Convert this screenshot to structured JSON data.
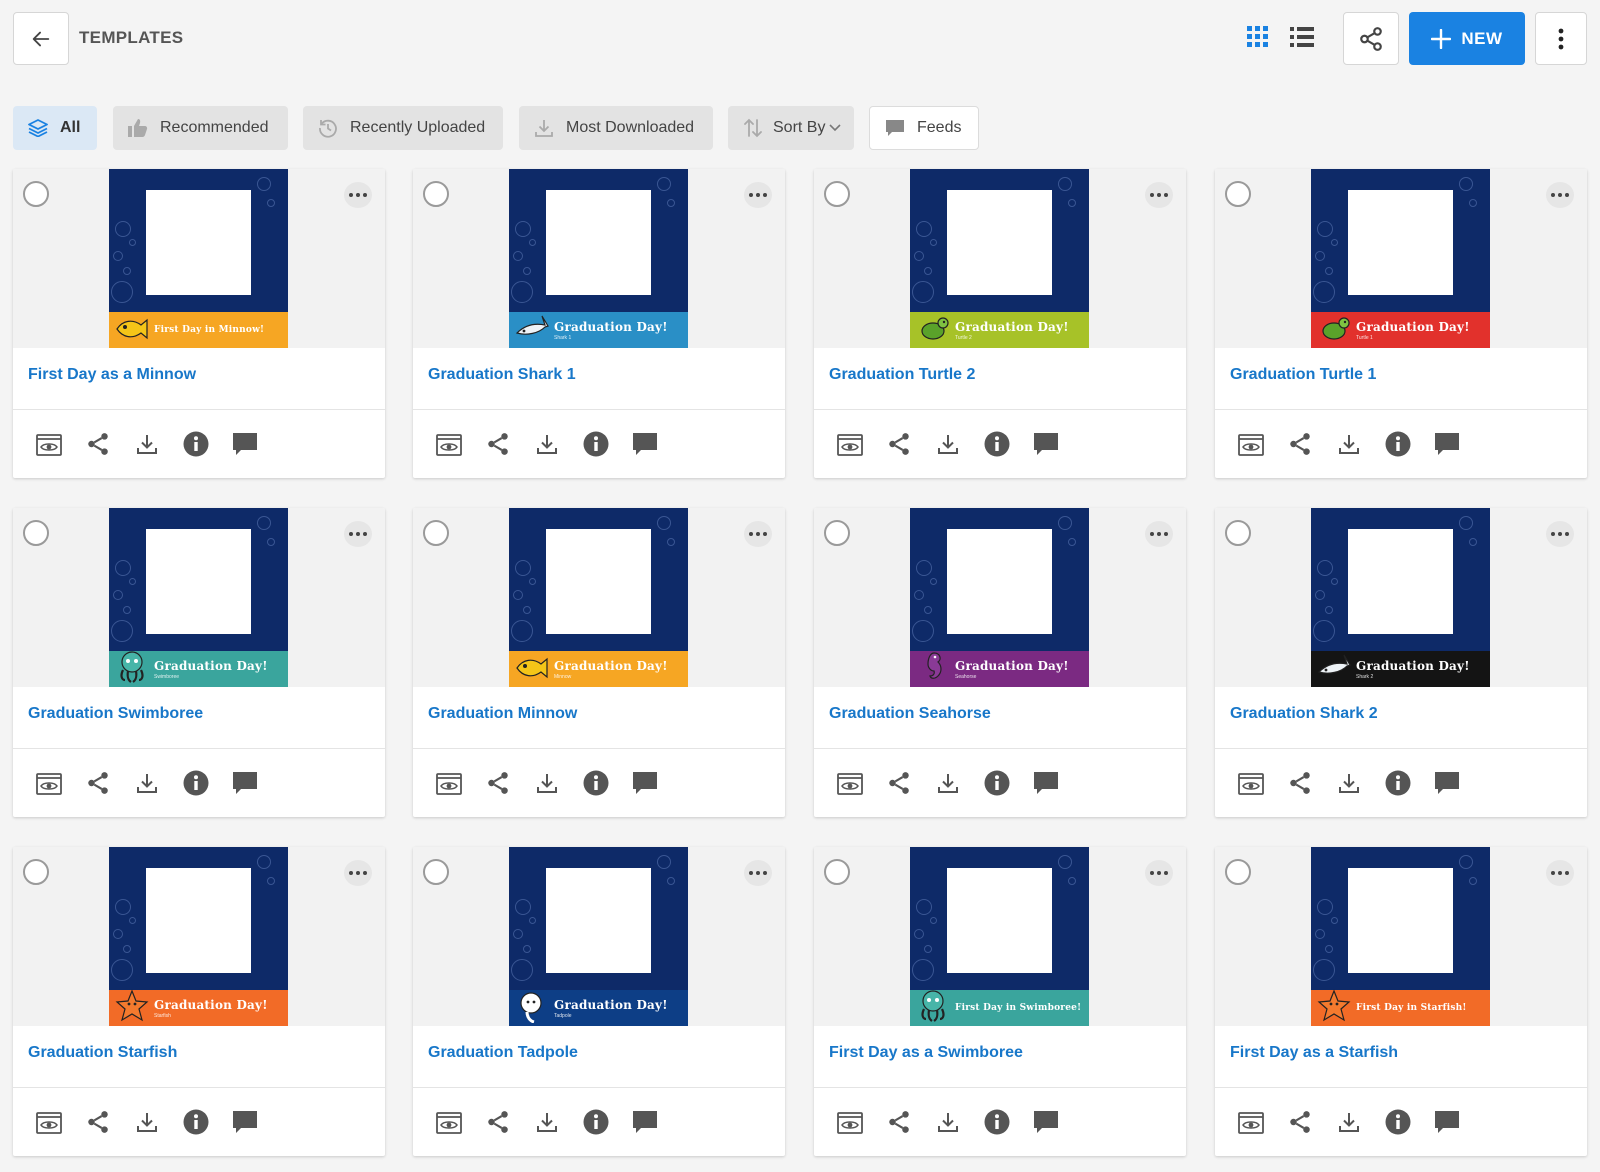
{
  "header": {
    "title": "TEMPLATES",
    "new_label": "NEW",
    "icons": {
      "back": "arrow-left-icon",
      "grid_view": "grid-icon",
      "list_view": "list-icon",
      "share": "share-icon",
      "new": "plus-icon",
      "more": "vertical-dots-icon"
    }
  },
  "filters": [
    {
      "label": "All",
      "icon": "layers-icon",
      "active": true
    },
    {
      "label": "Recommended",
      "icon": "thumbs-up-icon"
    },
    {
      "label": "Recently Uploaded",
      "icon": "history-icon"
    },
    {
      "label": "Most Downloaded",
      "icon": "download-icon"
    },
    {
      "label": "Sort By",
      "icon": "sort-icon",
      "dropdown": true
    },
    {
      "label": "Feeds",
      "icon": "comment-icon"
    }
  ],
  "colors": {
    "accent": "#1a82e2",
    "title_link": "#1877c9",
    "thumb_background": "#0e2a68"
  },
  "card_actions": [
    "preview-icon",
    "share-icon",
    "download-icon",
    "info-icon",
    "comment-icon"
  ],
  "templates": [
    {
      "title": "First Day as a Minnow",
      "banner_text": "First Day in Minnow!",
      "banner_sub": "",
      "banner_color": "#f6a623",
      "mascot": "fish-icon"
    },
    {
      "title": "Graduation Shark 1",
      "banner_text": "Graduation Day!",
      "banner_sub": "Shark 1",
      "banner_color": "#2a8fc6",
      "mascot": "shark-icon"
    },
    {
      "title": "Graduation Turtle 2",
      "banner_text": "Graduation Day!",
      "banner_sub": "Turtle 2",
      "banner_color": "#a7c228",
      "mascot": "turtle-icon"
    },
    {
      "title": "Graduation Turtle 1",
      "banner_text": "Graduation Day!",
      "banner_sub": "Turtle 1",
      "banner_color": "#e2312c",
      "mascot": "turtle-icon"
    },
    {
      "title": "Graduation Swimboree",
      "banner_text": "Graduation Day!",
      "banner_sub": "Swimboree",
      "banner_color": "#3aa59d",
      "mascot": "octopus-icon"
    },
    {
      "title": "Graduation Minnow",
      "banner_text": "Graduation Day!",
      "banner_sub": "Minnow",
      "banner_color": "#f6a623",
      "mascot": "fish-icon"
    },
    {
      "title": "Graduation Seahorse",
      "banner_text": "Graduation Day!",
      "banner_sub": "Seahorse",
      "banner_color": "#7b2a82",
      "mascot": "seahorse-icon"
    },
    {
      "title": "Graduation Shark 2",
      "banner_text": "Graduation Day!",
      "banner_sub": "Shark 2",
      "banner_color": "#141414",
      "mascot": "shark-icon"
    },
    {
      "title": "Graduation Starfish",
      "banner_text": "Graduation Day!",
      "banner_sub": "Starfish",
      "banner_color": "#f26b27",
      "mascot": "starfish-icon"
    },
    {
      "title": "Graduation Tadpole",
      "banner_text": "Graduation Day!",
      "banner_sub": "Tadpole",
      "banner_color": "#0d3e86",
      "mascot": "tadpole-icon"
    },
    {
      "title": "First Day as a Swimboree",
      "banner_text": "First Day in Swimboree!",
      "banner_sub": "",
      "banner_color": "#3aa59d",
      "mascot": "octopus-icon"
    },
    {
      "title": "First Day as a Starfish",
      "banner_text": "First Day in Starfish!",
      "banner_sub": "",
      "banner_color": "#f26b27",
      "mascot": "starfish-icon"
    }
  ]
}
